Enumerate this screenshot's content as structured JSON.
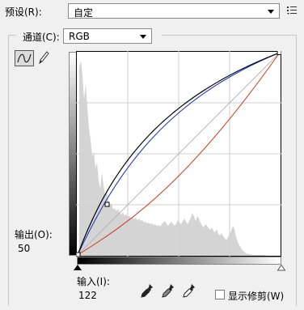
{
  "preset": {
    "label": "预设(R):",
    "value": "自定"
  },
  "channel": {
    "label": "通道(C):",
    "value": "RGB"
  },
  "output": {
    "label": "输出(O):",
    "value": "50"
  },
  "input": {
    "label": "输入(I):",
    "value": "122"
  },
  "show_clipping": {
    "label": "显示修剪(W)",
    "checked": false
  },
  "icons": {
    "preset_options": "list-options-icon",
    "curve_tool": "curve-tool-icon",
    "pencil_tool": "pencil-tool-icon",
    "black_eyedropper": "black-point-eyedropper-icon",
    "gray_eyedropper": "gray-point-eyedropper-icon",
    "white_eyedropper": "white-point-eyedropper-icon"
  },
  "colors": {
    "curve_rgb": "#000000",
    "curve_red": "#c83a1e",
    "curve_blue": "#2030c0",
    "histogram": "#d4d4d4",
    "baseline": "#b8b8b8"
  }
}
